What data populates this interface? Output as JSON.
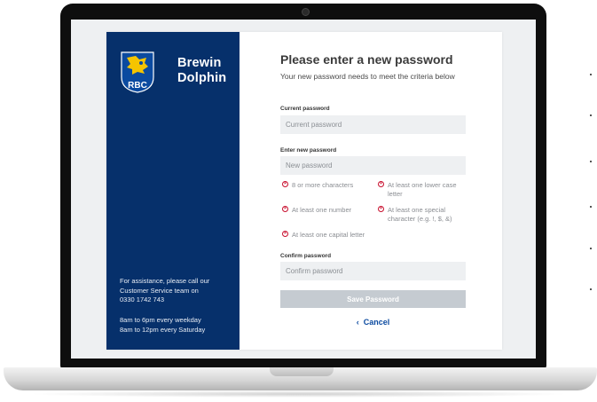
{
  "brand": {
    "name": "Brewin\nDolphin",
    "logo_text": "RBC"
  },
  "sidebar": {
    "assistance": [
      "For assistance, please call our",
      "Customer Service team on",
      "0330 1742 743"
    ],
    "hours": [
      "8am to 6pm every weekday",
      "8am to 12pm every Saturday"
    ]
  },
  "form": {
    "title": "Please enter a new password",
    "subtitle": "Your new password needs to meet the criteria below",
    "current": {
      "label": "Current password",
      "placeholder": "Current password"
    },
    "new": {
      "label": "Enter new password",
      "placeholder": "New password"
    },
    "confirm": {
      "label": "Confirm password",
      "placeholder": "Confirm password"
    },
    "criteria": [
      {
        "text": "8 or more characters",
        "status": "unmet",
        "icon": "x-circle-icon"
      },
      {
        "text": "At least one lower case letter",
        "status": "unmet",
        "icon": "x-circle-icon"
      },
      {
        "text": "At least one number",
        "status": "unmet",
        "icon": "x-circle-icon"
      },
      {
        "text": "At least one special character (e.g. !, $, &)",
        "status": "unmet",
        "icon": "x-circle-icon"
      },
      {
        "text": "At least one capital letter",
        "status": "unmet",
        "icon": "x-circle-icon"
      }
    ],
    "save_label": "Save Password",
    "cancel_label": "Cancel",
    "cancel_icon": "chevron-left-icon"
  },
  "colors": {
    "sidebar_bg": "#06306b",
    "error": "#c8102e",
    "save_disabled": "#c5cbd1",
    "link": "#0b4aa0",
    "logo_gold": "#f5c400"
  }
}
